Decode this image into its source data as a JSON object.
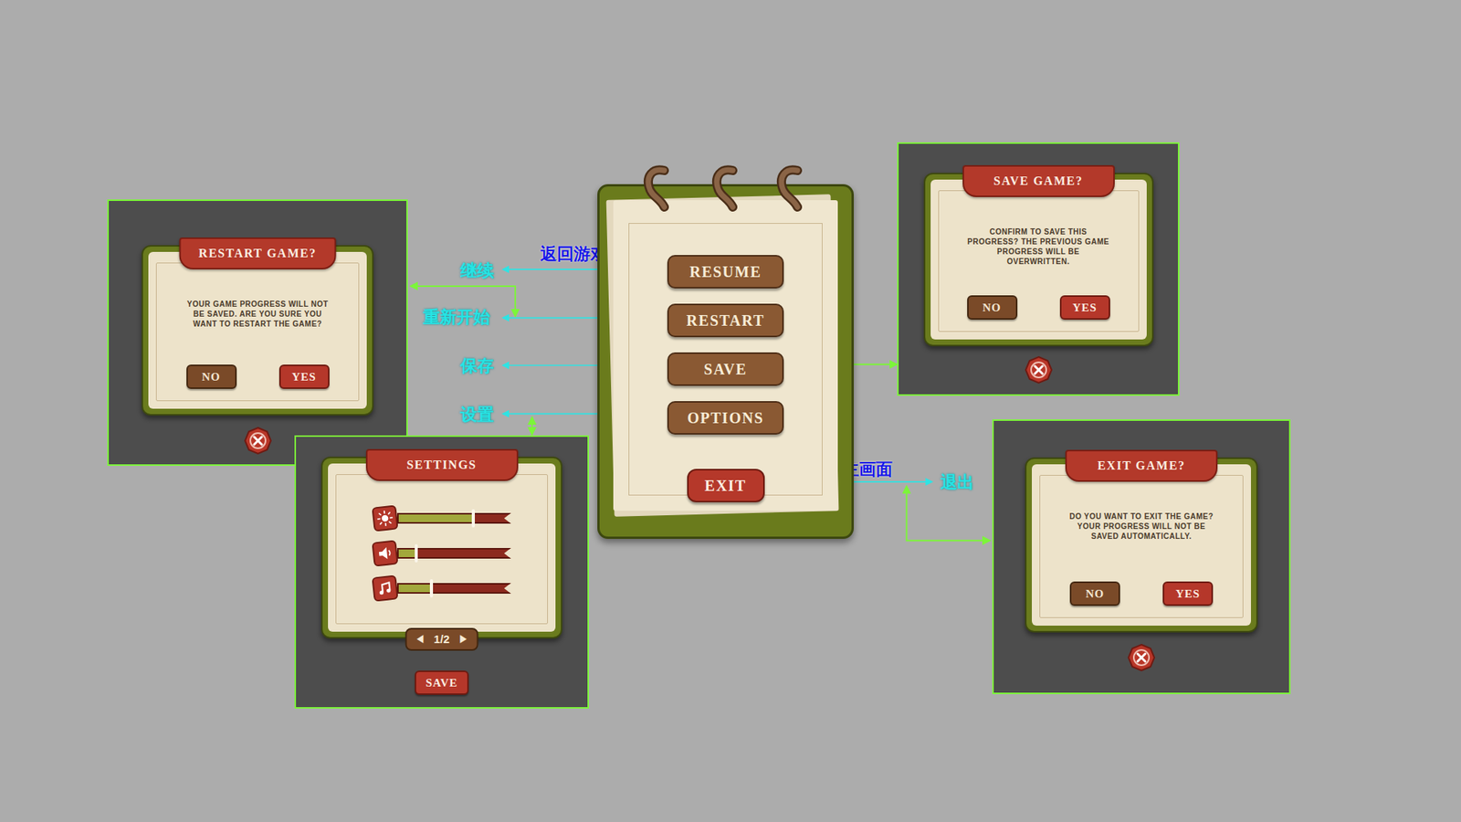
{
  "annotations": [
    {
      "text": "返回游戏画面",
      "kind": "caption"
    },
    {
      "text": "继续",
      "kind": "label"
    },
    {
      "text": "重新开始",
      "kind": "label"
    },
    {
      "text": "保存",
      "kind": "label"
    },
    {
      "text": "设置",
      "kind": "label"
    },
    {
      "text": "退回到主画面",
      "kind": "caption"
    },
    {
      "text": "退出",
      "kind": "label"
    }
  ],
  "pause_menu": {
    "buttons": [
      {
        "label": "RESUME"
      },
      {
        "label": "RESTART"
      },
      {
        "label": "SAVE"
      },
      {
        "label": "OPTIONS"
      }
    ],
    "exit": "EXIT"
  },
  "restart_dialog": {
    "title": "RESTART GAME?",
    "message": "YOUR GAME PROGRESS WILL NOT BE SAVED. ARE YOU SURE YOU WANT TO RESTART THE GAME?",
    "no": "NO",
    "yes": "YES"
  },
  "settings_dialog": {
    "title": "SETTINGS",
    "sliders": [
      {
        "kind": "brightness",
        "level": 0.67
      },
      {
        "kind": "sound",
        "level": 0.17
      },
      {
        "kind": "music",
        "level": 0.3
      }
    ],
    "pager": {
      "prev": "◀",
      "page": "1/2",
      "next": "▶"
    },
    "save": "SAVE"
  },
  "save_dialog": {
    "title": "SAVE GAME?",
    "message": "CONFIRM TO SAVE THIS PROGRESS? THE PREVIOUS GAME PROGRESS WILL BE OVERWRITTEN.",
    "no": "NO",
    "yes": "YES"
  },
  "exit_dialog": {
    "title": "EXIT GAME?",
    "message": "DO YOU WANT TO EXIT THE GAME? YOUR PROGRESS WILL NOT BE SAVED AUTOMATICALLY.",
    "no": "NO",
    "yes": "YES"
  }
}
